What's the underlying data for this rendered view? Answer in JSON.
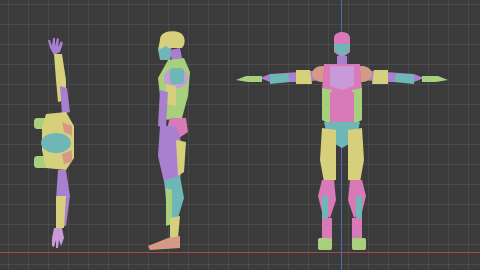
{
  "viewport": {
    "background_color": "#3b3b3b",
    "grid": true,
    "axis_x_color": "#a84848",
    "axis_y_color": "#4d6fa8"
  },
  "model": {
    "views": [
      "top",
      "side",
      "front"
    ],
    "palette": {
      "pink": "#d77ab7",
      "purple": "#a980cf",
      "green": "#a7cf7c",
      "yellow": "#d6d07c",
      "teal": "#6fb7b7",
      "salmon": "#d49a86",
      "lavender": "#c89ad8"
    }
  }
}
